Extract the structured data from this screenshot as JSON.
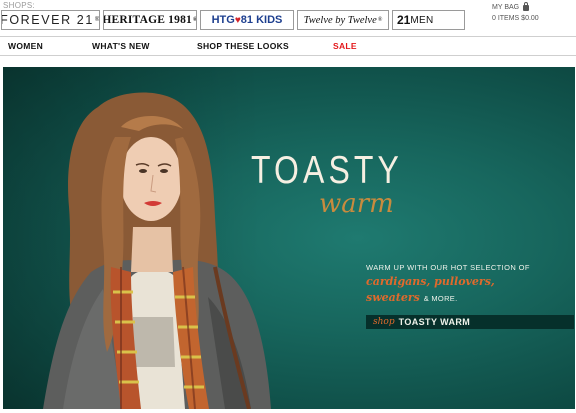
{
  "header": {
    "shops_label": "SHOPS:",
    "brands": [
      {
        "label": "FOREVER 21",
        "mark": "®"
      },
      {
        "label": "HERITAGE 1981",
        "mark": "®"
      },
      {
        "label_a": "HTG",
        "label_b": "81",
        "label_c": "KIDS",
        "heart": "♥"
      },
      {
        "label": "Twelve by Twelve",
        "mark": "®"
      },
      {
        "label_a": "21",
        "label_b": "MEN"
      }
    ],
    "bag": {
      "label": "MY BAG",
      "items": "0 ITEMS $0.00"
    }
  },
  "nav": {
    "items": [
      "WOMEN",
      "WHAT'S NEW",
      "SHOP THESE LOOKS",
      "SALE"
    ]
  },
  "hero": {
    "headline": "TOASTY",
    "subheadline": "warm",
    "promo_intro": "WARM UP WITH OUR HOT SELECTION OF",
    "promo_line1": "cardigans, pullovers,",
    "promo_line2": "sweaters",
    "promo_more": "& MORE.",
    "cta_prefix": "shop",
    "cta_label": "TOASTY WARM"
  },
  "colors": {
    "background_teal": "#17665d",
    "accent_orange": "#e06a2c",
    "headline_cream": "#f6efe2",
    "warm_gold": "#c88b3e",
    "sale_red": "#e3171b",
    "kids_blue": "#1d3f8f"
  },
  "icons": {
    "bag": "shopping-bag-icon"
  }
}
